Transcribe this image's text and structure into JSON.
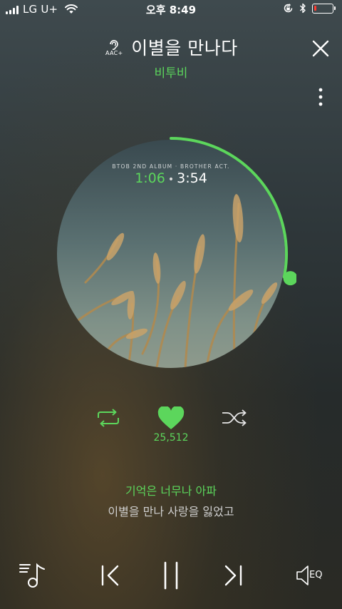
{
  "status_bar": {
    "carrier": "LG U+",
    "time": "오후 8:49",
    "battery_level": 0.15,
    "icons": [
      "signal-icon",
      "wifi-icon",
      "orientation-lock-icon",
      "bluetooth-icon",
      "battery-icon"
    ]
  },
  "header": {
    "quality_label": "AAC+",
    "title": "이별을 만나다",
    "artist": "비투비",
    "icons": [
      "aac-quality-icon",
      "close-icon",
      "more-vertical-icon"
    ]
  },
  "album": {
    "caption": "BTOB 2ND ALBUM · BROTHER ACT.",
    "elapsed": "1:06",
    "separator": "•",
    "total": "3:54",
    "progress": 0.282
  },
  "actions": {
    "like_count": "25,512",
    "liked": true,
    "icons": [
      "repeat-icon",
      "heart-icon",
      "shuffle-icon"
    ]
  },
  "lyrics": {
    "current": "기억은 너무나 아파",
    "next": "이별을 만나 사랑을 잃었고"
  },
  "player_controls": {
    "eq_label": "EQ",
    "icons": [
      "playlist-icon",
      "previous-icon",
      "pause-icon",
      "next-icon",
      "eq-speaker-icon"
    ]
  },
  "colors": {
    "accent": "#5cd65c",
    "text": "#ffffff",
    "battery_low": "#ff3b30"
  }
}
